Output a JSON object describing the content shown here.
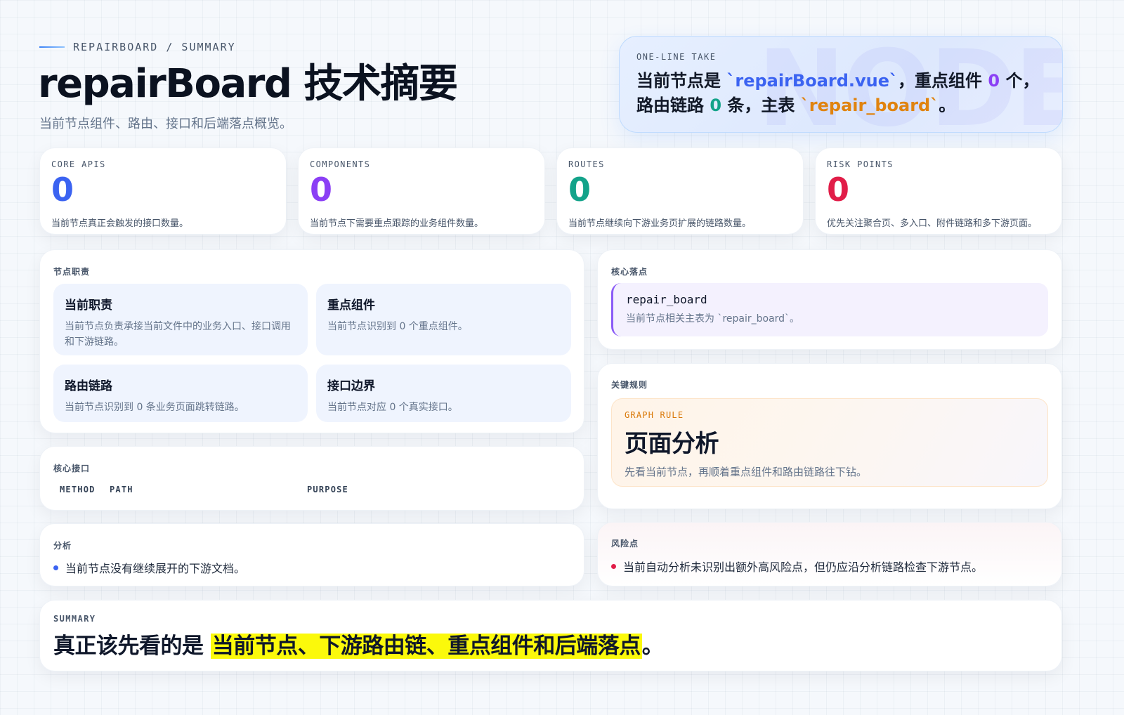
{
  "header": {
    "eyebrow": "REPAIRBOARD / SUMMARY",
    "title": "repairBoard 技术摘要",
    "subtitle": "当前节点组件、路由、接口和后端落点概览。"
  },
  "take": {
    "label": "ONE-LINE TAKE",
    "watermark": "NODE",
    "p1": "当前节点是 ",
    "file": "`repairBoard.vue`",
    "p2": "，重点组件 ",
    "components": "0",
    "p3": " 个，路由链路 ",
    "routes": "0",
    "p4": " 条，主表 ",
    "table": "`repair_board`",
    "p5": "。"
  },
  "stats": [
    {
      "label": "CORE APIS",
      "value": "0",
      "desc": "当前节点真正会触发的接口数量。",
      "color": "#3b63f1"
    },
    {
      "label": "COMPONENTS",
      "value": "0",
      "desc": "当前节点下需要重点跟踪的业务组件数量。",
      "color": "#8b3ff5"
    },
    {
      "label": "ROUTES",
      "value": "0",
      "desc": "当前节点继续向下游业务页扩展的链路数量。",
      "color": "#13a38a"
    },
    {
      "label": "RISK POINTS",
      "value": "0",
      "desc": "优先关注聚合页、多入口、附件链路和多下游页面。",
      "color": "#e11d48"
    }
  ],
  "duties": {
    "label": "节点职责",
    "items": [
      {
        "title": "当前职责",
        "text": "当前节点负责承接当前文件中的业务入口、接口调用和下游链路。"
      },
      {
        "title": "重点组件",
        "text": "当前节点识别到 0 个重点组件。"
      },
      {
        "title": "路由链路",
        "text": "当前节点识别到 0 条业务页面跳转链路。"
      },
      {
        "title": "接口边界",
        "text": "当前节点对应 0 个真实接口。"
      }
    ]
  },
  "core_apis": {
    "label": "核心接口",
    "columns": [
      "METHOD",
      "PATH",
      "PURPOSE"
    ]
  },
  "analysis": {
    "label": "分析",
    "items": [
      "当前节点没有继续展开的下游文档。"
    ]
  },
  "landing": {
    "label": "核心落点",
    "table": "repair_board",
    "text": "当前节点相关主表为 `repair_board`。"
  },
  "rules": {
    "label": "关键规则",
    "tag": "GRAPH RULE",
    "title": "页面分析",
    "text": "先看当前节点，再顺着重点组件和路由链路往下钻。"
  },
  "risks": {
    "label": "风险点",
    "items": [
      "当前自动分析未识别出额外高风险点，但仍应沿分析链路检查下游节点。"
    ]
  },
  "summary": {
    "label": "SUMMARY",
    "lead": "真正该先看的是 ",
    "highlight": "当前节点、下游路由链、重点组件和后端落点",
    "tail": "。"
  },
  "colors": {
    "accent_blue": "#3b63f1",
    "accent_purple": "#8b3ff5",
    "accent_green": "#13a38a",
    "accent_orange": "#e0830f",
    "risk_red": "#e11d48",
    "highlight_yellow": "#fbf90b"
  }
}
